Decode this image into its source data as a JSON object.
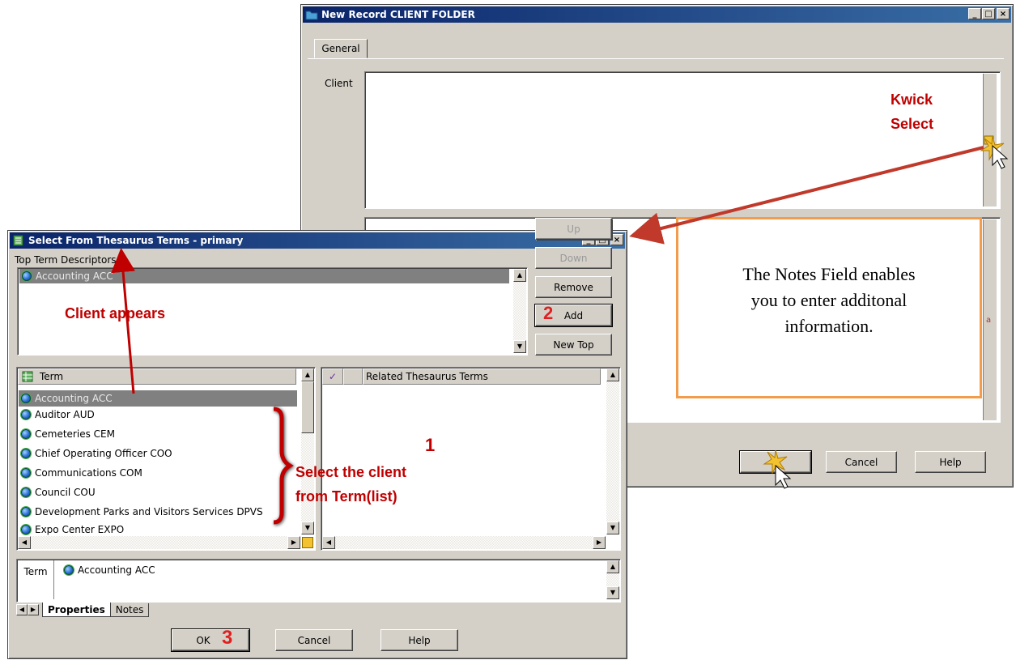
{
  "client_folder_window": {
    "title": "New Record CLIENT FOLDER",
    "tab_general": "General",
    "client_label": "Client",
    "buttons": {
      "cancel": "Cancel",
      "help": "Help"
    }
  },
  "thesaurus_dialog": {
    "title": "Select From Thesaurus Terms - primary",
    "top_term_header": "Top Term Descriptors",
    "top_terms": [
      "Accounting  ACC"
    ],
    "side_buttons": {
      "up": "Up",
      "down": "Down",
      "remove": "Remove",
      "add": "Add",
      "new_top": "New Top"
    },
    "term_header": "Term",
    "terms": [
      "Accounting  ACC",
      "Auditor  AUD",
      "Cemeteries  CEM",
      "Chief Operating Officer  COO",
      "Communications  COM",
      "Council  COU",
      "Development Parks and Visitors Services  DPVS",
      "Expo Center  EXPO"
    ],
    "related_header": "Related Thesaurus Terms",
    "detail_label": "Term",
    "detail_value": "Accounting  ACC",
    "bottom_tabs": {
      "properties": "Properties",
      "notes": "Notes"
    },
    "buttons": {
      "ok": "OK",
      "cancel": "Cancel",
      "help": "Help"
    }
  },
  "annotations": {
    "kwick_select_1": "Kwick",
    "kwick_select_2": "Select",
    "client_appears": "Client appears",
    "select_client_1": "Select the client",
    "select_client_2": "from Term(list)",
    "step1": "1",
    "step2": "2",
    "step3": "3",
    "notes_box": [
      "The Notes Field enables",
      "you to enter additonal",
      "information."
    ],
    "arrow_color": "#c0392b",
    "note_border_color": "#f39c4b"
  }
}
